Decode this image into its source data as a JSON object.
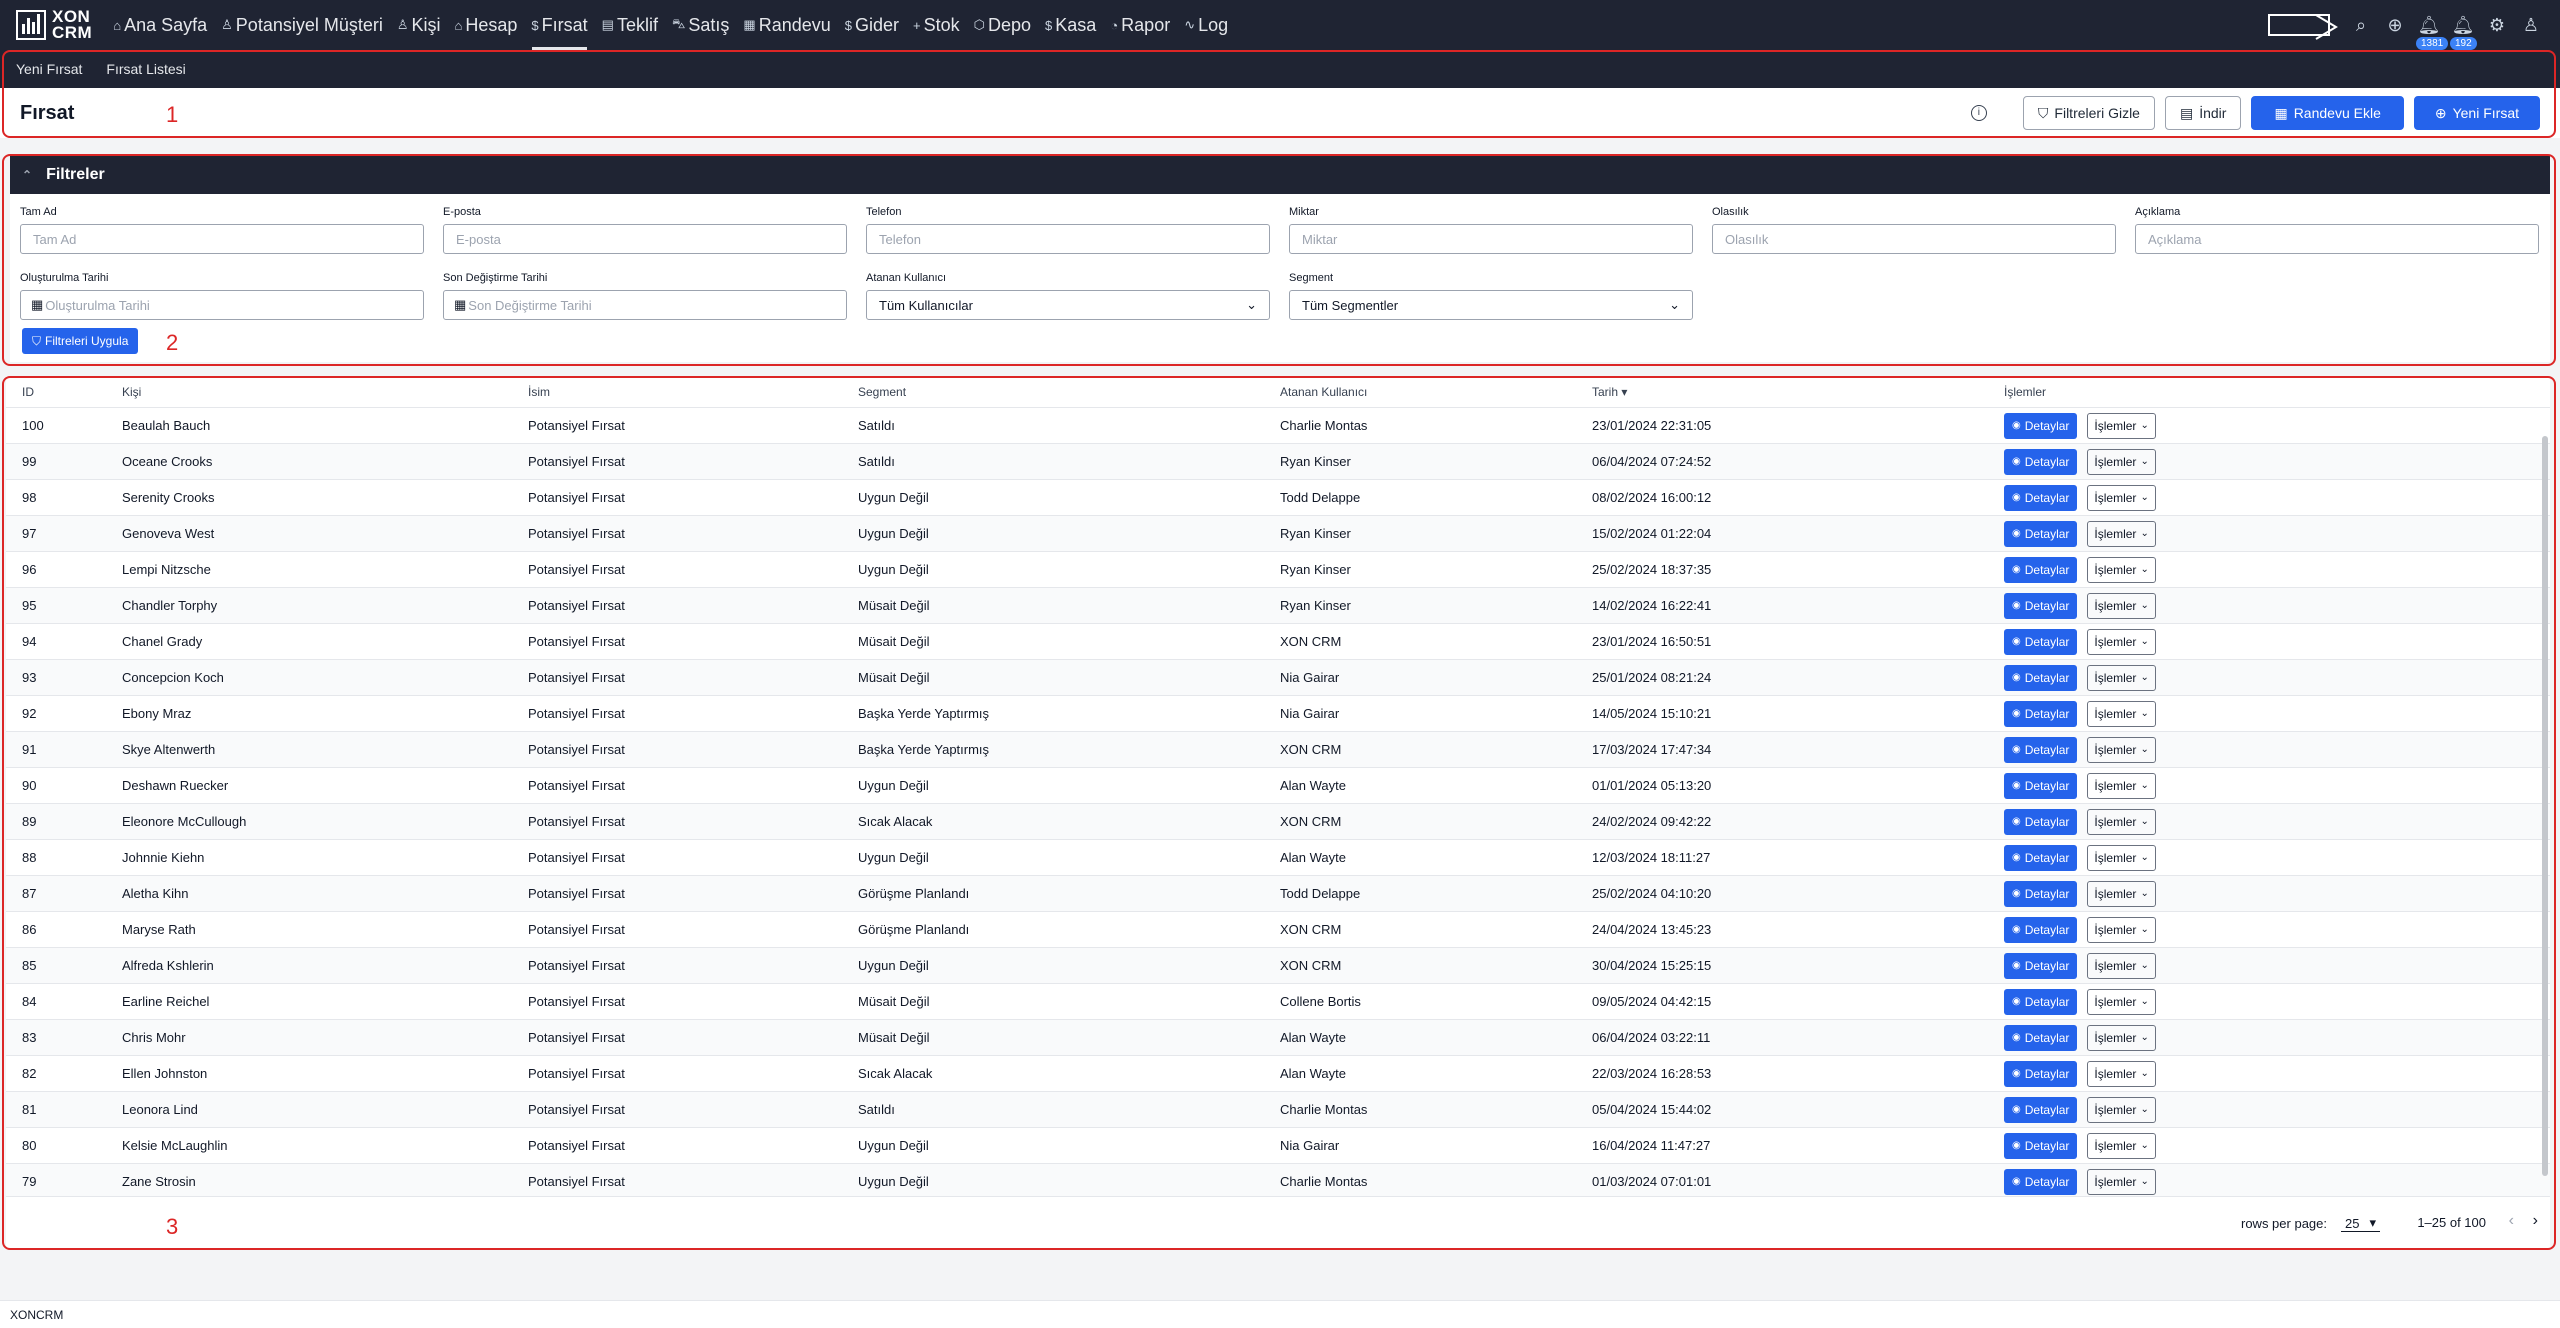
{
  "app": {
    "logo_line1": "XON",
    "logo_line2": "CRM",
    "footer_text": "XONCRM"
  },
  "nav": {
    "items": [
      {
        "label": "Ana Sayfa",
        "icon": "home-icon",
        "glyph": "⌂"
      },
      {
        "label": "Potansiyel Müşteri",
        "icon": "person-icon",
        "glyph": "♙"
      },
      {
        "label": "Kişi",
        "icon": "people-icon",
        "glyph": "♙"
      },
      {
        "label": "Hesap",
        "icon": "home-icon",
        "glyph": "⌂"
      },
      {
        "label": "Fırsat",
        "icon": "dollar-icon",
        "glyph": "$"
      },
      {
        "label": "Teklif",
        "icon": "document-icon",
        "glyph": "▤"
      },
      {
        "label": "Satış",
        "icon": "cart-icon",
        "glyph": "⛍"
      },
      {
        "label": "Randevu",
        "icon": "calendar-icon",
        "glyph": "▦"
      },
      {
        "label": "Gider",
        "icon": "dollar-icon",
        "glyph": "$"
      },
      {
        "label": "Stok",
        "icon": "plus-icon",
        "glyph": "+"
      },
      {
        "label": "Depo",
        "icon": "box-icon",
        "glyph": "⬡"
      },
      {
        "label": "Kasa",
        "icon": "dollar-icon",
        "glyph": "$"
      },
      {
        "label": "Rapor",
        "icon": "chart-icon",
        "glyph": "◔"
      },
      {
        "label": "Log",
        "icon": "activity-icon",
        "glyph": "∿"
      }
    ],
    "active": "Fırsat",
    "badge_1": "1381",
    "badge_2": "192"
  },
  "subnav": {
    "new": "Yeni Fırsat",
    "list": "Fırsat Listesi"
  },
  "page": {
    "title": "Fırsat",
    "btn_hide_filters": "Filtreleri Gizle",
    "btn_download": "İndir",
    "btn_add_appointment": "Randevu Ekle",
    "btn_new_opportunity": "Yeni Fırsat"
  },
  "annotations": {
    "one": "1",
    "two": "2",
    "three": "3"
  },
  "filters": {
    "title": "Filtreler",
    "row1": [
      {
        "label": "Tam Ad",
        "placeholder": "Tam Ad"
      },
      {
        "label": "E-posta",
        "placeholder": "E-posta"
      },
      {
        "label": "Telefon",
        "placeholder": "Telefon"
      },
      {
        "label": "Miktar",
        "placeholder": "Miktar"
      },
      {
        "label": "Olasılık",
        "placeholder": "Olasılık"
      },
      {
        "label": "Açıklama",
        "placeholder": "Açıklama"
      }
    ],
    "created_label": "Oluşturulma Tarihi",
    "created_placeholder": "Oluşturulma Tarihi",
    "modified_label": "Son Değiştirme Tarihi",
    "modified_placeholder": "Son Değiştirme Tarihi",
    "user_label": "Atanan Kullanıcı",
    "user_value": "Tüm Kullanıcılar",
    "segment_label": "Segment",
    "segment_value": "Tüm Segmentler",
    "apply": "Filtreleri Uygula"
  },
  "table": {
    "headers": [
      "ID",
      "Kişi",
      "İsim",
      "Segment",
      "Atanan Kullanıcı",
      "Tarih",
      "İşlemler"
    ],
    "detail_label": "Detaylar",
    "ops_label": "İşlemler",
    "rows": [
      [
        "100",
        "Beaulah Bauch",
        "Potansiyel Fırsat",
        "Satıldı",
        "Charlie Montas",
        "23/01/2024 22:31:05"
      ],
      [
        "99",
        "Oceane Crooks",
        "Potansiyel Fırsat",
        "Satıldı",
        "Ryan Kinser",
        "06/04/2024 07:24:52"
      ],
      [
        "98",
        "Serenity Crooks",
        "Potansiyel Fırsat",
        "Uygun Değil",
        "Todd Delappe",
        "08/02/2024 16:00:12"
      ],
      [
        "97",
        "Genoveva West",
        "Potansiyel Fırsat",
        "Uygun Değil",
        "Ryan Kinser",
        "15/02/2024 01:22:04"
      ],
      [
        "96",
        "Lempi Nitzsche",
        "Potansiyel Fırsat",
        "Uygun Değil",
        "Ryan Kinser",
        "25/02/2024 18:37:35"
      ],
      [
        "95",
        "Chandler Torphy",
        "Potansiyel Fırsat",
        "Müsait Değil",
        "Ryan Kinser",
        "14/02/2024 16:22:41"
      ],
      [
        "94",
        "Chanel Grady",
        "Potansiyel Fırsat",
        "Müsait Değil",
        "XON CRM",
        "23/01/2024 16:50:51"
      ],
      [
        "93",
        "Concepcion Koch",
        "Potansiyel Fırsat",
        "Müsait Değil",
        "Nia Gairar",
        "25/01/2024 08:21:24"
      ],
      [
        "92",
        "Ebony Mraz",
        "Potansiyel Fırsat",
        "Başka Yerde Yaptırmış",
        "Nia Gairar",
        "14/05/2024 15:10:21"
      ],
      [
        "91",
        "Skye Altenwerth",
        "Potansiyel Fırsat",
        "Başka Yerde Yaptırmış",
        "XON CRM",
        "17/03/2024 17:47:34"
      ],
      [
        "90",
        "Deshawn Ruecker",
        "Potansiyel Fırsat",
        "Uygun Değil",
        "Alan Wayte",
        "01/01/2024 05:13:20"
      ],
      [
        "89",
        "Eleonore McCullough",
        "Potansiyel Fırsat",
        "Sıcak Alacak",
        "XON CRM",
        "24/02/2024 09:42:22"
      ],
      [
        "88",
        "Johnnie Kiehn",
        "Potansiyel Fırsat",
        "Uygun Değil",
        "Alan Wayte",
        "12/03/2024 18:11:27"
      ],
      [
        "87",
        "Aletha Kihn",
        "Potansiyel Fırsat",
        "Görüşme Planlandı",
        "Todd Delappe",
        "25/02/2024 04:10:20"
      ],
      [
        "86",
        "Maryse Rath",
        "Potansiyel Fırsat",
        "Görüşme Planlandı",
        "XON CRM",
        "24/04/2024 13:45:23"
      ],
      [
        "85",
        "Alfreda Kshlerin",
        "Potansiyel Fırsat",
        "Uygun Değil",
        "XON CRM",
        "30/04/2024 15:25:15"
      ],
      [
        "84",
        "Earline Reichel",
        "Potansiyel Fırsat",
        "Müsait Değil",
        "Collene Bortis",
        "09/05/2024 04:42:15"
      ],
      [
        "83",
        "Chris Mohr",
        "Potansiyel Fırsat",
        "Müsait Değil",
        "Alan Wayte",
        "06/04/2024 03:22:11"
      ],
      [
        "82",
        "Ellen Johnston",
        "Potansiyel Fırsat",
        "Sıcak Alacak",
        "Alan Wayte",
        "22/03/2024 16:28:53"
      ],
      [
        "81",
        "Leonora Lind",
        "Potansiyel Fırsat",
        "Satıldı",
        "Charlie Montas",
        "05/04/2024 15:44:02"
      ],
      [
        "80",
        "Kelsie McLaughlin",
        "Potansiyel Fırsat",
        "Uygun Değil",
        "Nia Gairar",
        "16/04/2024 11:47:27"
      ],
      [
        "79",
        "Zane Strosin",
        "Potansiyel Fırsat",
        "Uygun Değil",
        "Charlie Montas",
        "01/03/2024 07:01:01"
      ]
    ]
  },
  "pagination": {
    "rows_per_page_label": "rows per page:",
    "rows_per_page": "25",
    "range": "1–25 of 100"
  },
  "colors": {
    "nav_bg": "#1f2433",
    "primary": "#2563eb",
    "annotation": "#dc2626"
  }
}
